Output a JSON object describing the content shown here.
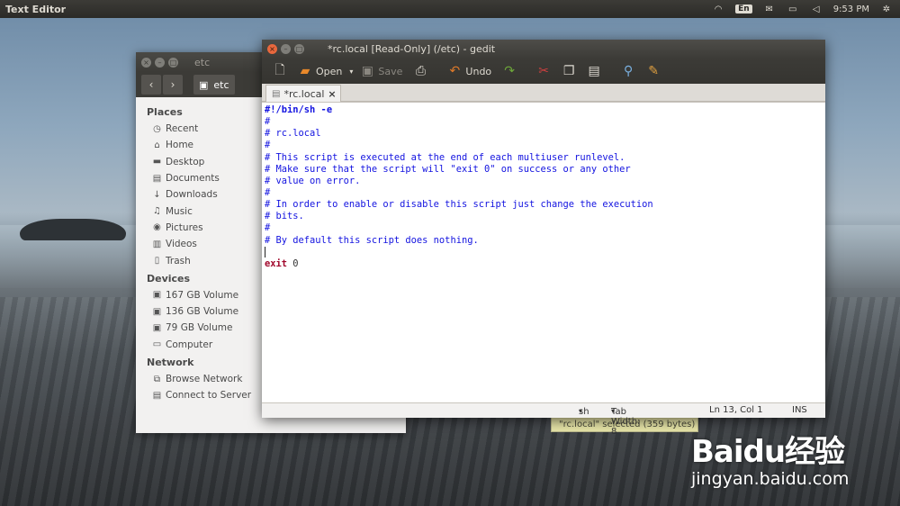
{
  "top_panel": {
    "app_title": "Text Editor",
    "keyboard_layout": "En",
    "time": "9:53 PM",
    "icons": [
      "wifi-icon",
      "keyboard-icon",
      "mail-icon",
      "battery-icon",
      "volume-icon",
      "gear-icon"
    ]
  },
  "nautilus": {
    "title": "etc",
    "breadcrumb": "etc",
    "sections": [
      {
        "label": "Places",
        "items": [
          {
            "label": "Recent",
            "icon": "clock-icon"
          },
          {
            "label": "Home",
            "icon": "home-icon"
          },
          {
            "label": "Desktop",
            "icon": "folder-icon"
          },
          {
            "label": "Documents",
            "icon": "document-icon"
          },
          {
            "label": "Downloads",
            "icon": "download-icon"
          },
          {
            "label": "Music",
            "icon": "music-icon"
          },
          {
            "label": "Pictures",
            "icon": "camera-icon"
          },
          {
            "label": "Videos",
            "icon": "film-icon"
          },
          {
            "label": "Trash",
            "icon": "trash-icon"
          }
        ]
      },
      {
        "label": "Devices",
        "items": [
          {
            "label": "167 GB Volume",
            "icon": "drive-icon"
          },
          {
            "label": "136 GB Volume",
            "icon": "drive-icon"
          },
          {
            "label": "79 GB Volume",
            "icon": "drive-icon"
          },
          {
            "label": "Computer",
            "icon": "computer-icon"
          }
        ]
      },
      {
        "label": "Network",
        "items": [
          {
            "label": "Browse Network",
            "icon": "network-icon"
          },
          {
            "label": "Connect to Server",
            "icon": "server-icon"
          }
        ]
      }
    ],
    "status": "\"rc.local\" selected  (359 bytes)"
  },
  "gedit": {
    "title": "*rc.local [Read-Only] (/etc) - gedit",
    "toolbar": {
      "open_label": "Open",
      "save_label": "Save",
      "undo_label": "Undo"
    },
    "tab_label": "*rc.local",
    "lines": [
      "#!/bin/sh -e",
      "#",
      "# rc.local",
      "#",
      "# This script is executed at the end of each multiuser runlevel.",
      "# Make sure that the script will \"exit 0\" on success or any other",
      "# value on error.",
      "#",
      "# In order to enable or disable this script just change the execution",
      "# bits.",
      "#",
      "# By default this script does nothing.",
      "",
      "exit 0"
    ],
    "exit_keyword": "exit",
    "exit_value": " 0",
    "status": {
      "language": "sh",
      "tab_width": "Tab Width: 8",
      "position": "Ln 13, Col 1",
      "mode": "INS"
    }
  },
  "watermark": {
    "brand": "Baidu经验",
    "url": "jingyan.baidu.com"
  }
}
